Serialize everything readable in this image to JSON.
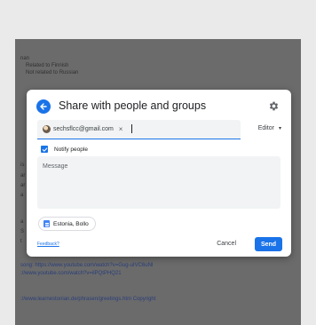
{
  "background_doc": {
    "lines_top": [
      "nan",
      "Related to Finnish",
      "Not related to Russian"
    ],
    "lines_mid": [
      "is",
      "ar",
      "ar",
      "a",
      "a",
      "S",
      "t"
    ],
    "lines_bottom": [
      "song: https://www.youtube.com/watch?v=Gug-uIVC6uNI",
      "://www.youtube.com/watch?v=ilPQtPHQ21",
      "://www.learnestonian.de/phrasen/greetings.htm Copyright"
    ]
  },
  "dialog": {
    "title": "Share with people and groups",
    "recipient_email": "sechsflcc@gmail.com",
    "chip_close": "×",
    "role_label": "Editor",
    "role_caret": "▾",
    "notify_label": "Notify people",
    "message_placeholder": "Message",
    "file_pill_label": "Estonia, Bollo",
    "feedback_label": "Feedback?",
    "cancel_label": "Cancel",
    "send_label": "Send"
  },
  "colors": {
    "accent": "#1a73e8",
    "frame": "#1155cc",
    "overlay": "#6b6b6b"
  }
}
